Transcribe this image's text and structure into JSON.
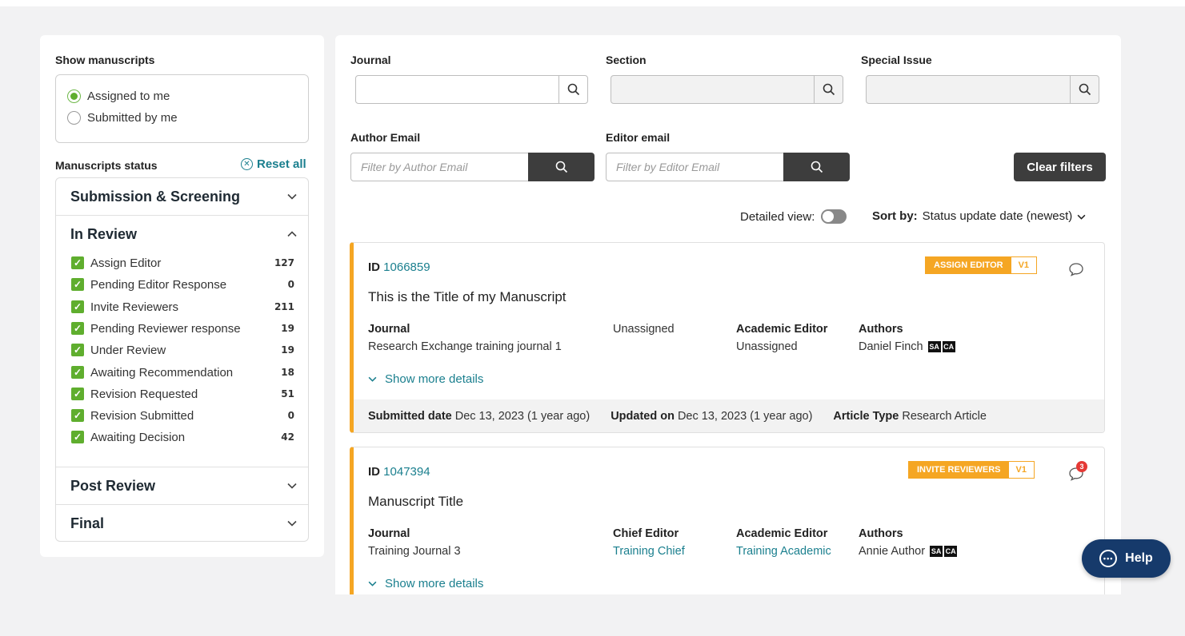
{
  "filters_sidebar": {
    "show_manuscripts_label": "Show manuscripts",
    "radio_options": [
      {
        "label": "Assigned to me",
        "selected": true
      },
      {
        "label": "Submitted by me",
        "selected": false
      }
    ],
    "status_label": "Manuscripts status",
    "reset_label": "Reset all",
    "groups": [
      {
        "label": "Submission & Screening",
        "expanded": false
      },
      {
        "label": "In Review",
        "expanded": true
      },
      {
        "label": "Post Review",
        "expanded": false
      },
      {
        "label": "Final",
        "expanded": false
      }
    ],
    "in_review_items": [
      {
        "label": "Assign Editor",
        "count": "127"
      },
      {
        "label": "Pending Editor Response",
        "count": "0"
      },
      {
        "label": "Invite Reviewers",
        "count": "211"
      },
      {
        "label": "Pending Reviewer response",
        "count": "19"
      },
      {
        "label": "Under Review",
        "count": "19"
      },
      {
        "label": "Awaiting Recommendation",
        "count": "18"
      },
      {
        "label": "Revision Requested",
        "count": "51"
      },
      {
        "label": "Revision Submitted",
        "count": "0"
      },
      {
        "label": "Awaiting Decision",
        "count": "42"
      }
    ]
  },
  "filters": {
    "journal_label": "Journal",
    "section_label": "Section",
    "special_issue_label": "Special Issue",
    "author_email_label": "Author Email",
    "author_email_placeholder": "Filter by Author Email",
    "editor_email_label": "Editor email",
    "editor_email_placeholder": "Filter by Editor Email",
    "clear_label": "Clear filters"
  },
  "sortbar": {
    "detailed_view_label": "Detailed view:",
    "sort_by_label": "Sort by:",
    "sort_value": "Status update date (newest)"
  },
  "manuscripts": [
    {
      "id_label": "ID",
      "id": "1066859",
      "status": "ASSIGN EDITOR",
      "version": "V1",
      "title": "This is the Title of my Manuscript",
      "journal_label": "Journal",
      "journal": "Research Exchange training journal 1",
      "chief_editor_label": "",
      "chief_editor": "Unassigned",
      "academic_editor_label": "Academic Editor",
      "academic_editor": "Unassigned",
      "authors_label": "Authors",
      "author": "Daniel Finch",
      "author_tags": [
        "SA",
        "CA"
      ],
      "show_more": "Show more details",
      "submitted_label": "Submitted date",
      "submitted": "Dec 13, 2023 (1 year ago)",
      "updated_label": "Updated on",
      "updated": "Dec 13, 2023 (1 year ago)",
      "article_type_label": "Article Type",
      "article_type": "Research Article",
      "notifications": ""
    },
    {
      "id_label": "ID",
      "id": "1047394",
      "status": "INVITE REVIEWERS",
      "version": "V1",
      "title": "Manuscript Title",
      "journal_label": "Journal",
      "journal": "Training Journal 3",
      "chief_editor_label": "Chief Editor",
      "chief_editor": "Training Chief",
      "academic_editor_label": "Academic Editor",
      "academic_editor": "Training Academic",
      "authors_label": "Authors",
      "author": "Annie Author",
      "author_tags": [
        "SA",
        "CA"
      ],
      "show_more": "Show more details",
      "notifications": "3"
    }
  ],
  "help": {
    "label": "Help"
  },
  "colors": {
    "accent": "#1a7f8e",
    "status_orange": "#f5a623",
    "check_green": "#5fae2e",
    "help_navy": "#163a6b"
  }
}
